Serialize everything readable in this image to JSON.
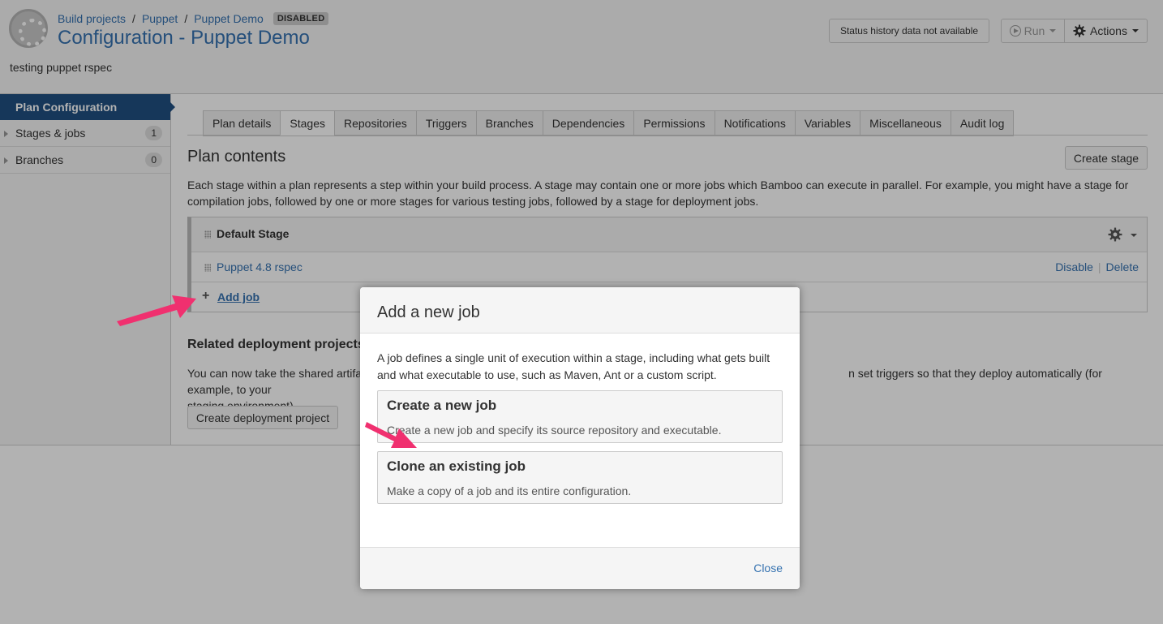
{
  "header": {
    "breadcrumb": [
      "Build projects",
      "Puppet",
      "Puppet Demo"
    ],
    "disabled_badge": "DISABLED",
    "title": "Configuration - Puppet Demo",
    "description": "testing puppet rspec",
    "status_history_label": "Status history data not available",
    "run_label": "Run",
    "actions_label": "Actions"
  },
  "sidebar": {
    "heading": "Plan Configuration",
    "items": [
      {
        "label": "Stages & jobs",
        "count": "1"
      },
      {
        "label": "Branches",
        "count": "0"
      }
    ]
  },
  "tabs": [
    "Plan details",
    "Stages",
    "Repositories",
    "Triggers",
    "Branches",
    "Dependencies",
    "Permissions",
    "Notifications",
    "Variables",
    "Miscellaneous",
    "Audit log"
  ],
  "active_tab": "Stages",
  "main": {
    "plan_contents_title": "Plan contents",
    "create_stage_label": "Create stage",
    "stage_description": "Each stage within a plan represents a step within your build process. A stage may contain one or more jobs which Bamboo can execute in parallel. For example, you might have a stage for compilation jobs, followed by one or more stages for various testing jobs, followed by a stage for deployment jobs.",
    "stage": {
      "name": "Default Stage",
      "job_name": "Puppet 4.8 rspec",
      "disable_label": "Disable",
      "delete_label": "Delete",
      "add_job_label": "Add job"
    },
    "related_title": "Related deployment projects",
    "related_desc_part1": "You can now take the shared artifa",
    "related_desc_part2": "n set triggers so that they deploy automatically (for example, to your",
    "related_desc_part3": "staging environment).",
    "create_deployment_label": "Create deployment project"
  },
  "dialog": {
    "title": "Add a new job",
    "description": "A job defines a single unit of execution within a stage, including what gets built and what executable to use, such as Maven, Ant or a custom script.",
    "options": [
      {
        "title": "Create a new job",
        "desc": "Create a new job and specify its source repository and executable."
      },
      {
        "title": "Clone an existing job",
        "desc": "Make a copy of a job and its entire configuration."
      }
    ],
    "close_label": "Close"
  },
  "colors": {
    "accent": "#3572b0",
    "sidebar_active": "#205081",
    "annotation_arrow": "#f0306f"
  }
}
